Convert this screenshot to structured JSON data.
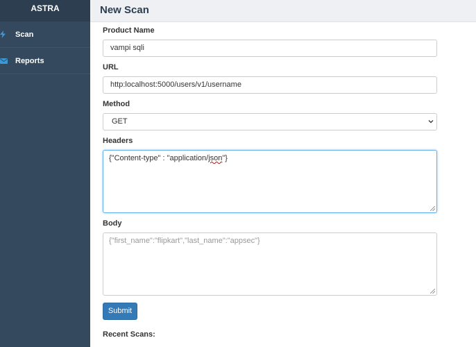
{
  "sidebar": {
    "brand": "ASTRA",
    "items": [
      {
        "label": "Scan",
        "icon": "bolt-icon"
      },
      {
        "label": "Reports",
        "icon": "envelope-icon"
      }
    ]
  },
  "header": {
    "title": "New Scan"
  },
  "form": {
    "product_name": {
      "label": "Product Name",
      "value": "vampi sqli"
    },
    "url": {
      "label": "URL",
      "value": "http:localhost:5000/users/v1/username"
    },
    "method": {
      "label": "Method",
      "selected": "GET"
    },
    "headers": {
      "label": "Headers",
      "value_prefix": "{\"Content-type\" : \"application/",
      "value_flagged": "json",
      "value_suffix": "\"}"
    },
    "body": {
      "label": "Body",
      "placeholder": "{\"first_name\":\"flipkart\",\"last_name\":\"appsec\"}"
    },
    "submit_label": "Submit"
  },
  "recent_scans": {
    "label": "Recent Scans:"
  },
  "colors": {
    "sidebar": "#34495e",
    "brand_bg": "#2c3e50",
    "accent": "#337ab7",
    "focus": "#66afe9"
  }
}
